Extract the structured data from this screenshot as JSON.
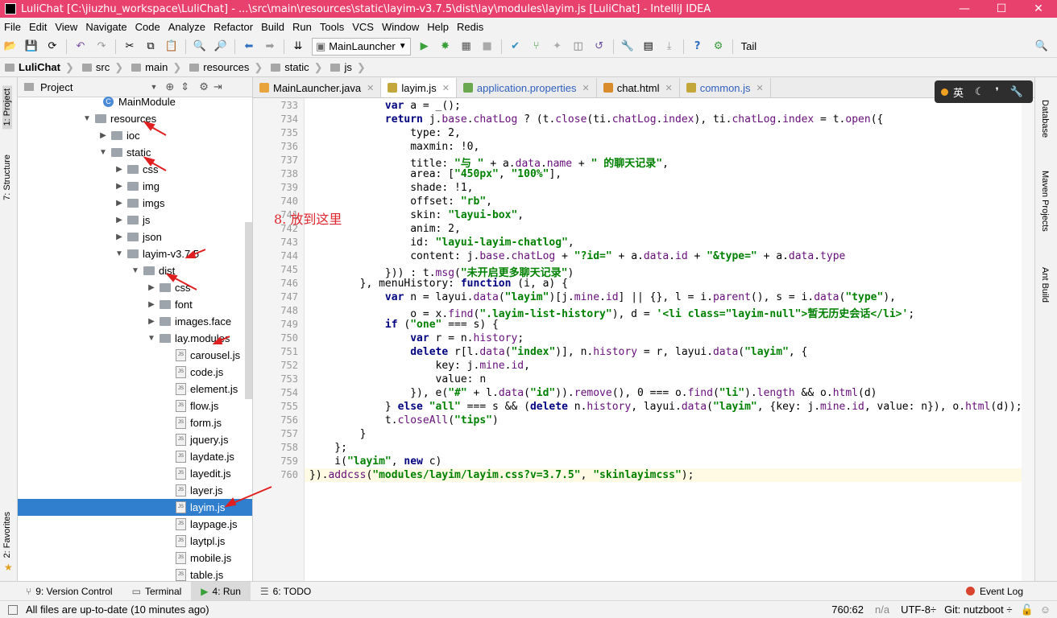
{
  "window": {
    "title": "LuliChat [C:\\jiuzhu_workspace\\LuliChat] - ...\\src\\main\\resources\\static\\layim-v3.7.5\\dist\\lay\\modules\\layim.js [LuliChat] - IntelliJ IDEA",
    "minimize": "—",
    "maximize": "☐",
    "close": "✕"
  },
  "menu": [
    "File",
    "Edit",
    "View",
    "Navigate",
    "Code",
    "Analyze",
    "Refactor",
    "Build",
    "Run",
    "Tools",
    "VCS",
    "Window",
    "Help",
    "Redis"
  ],
  "toolbar": {
    "run_config": "MainLauncher",
    "tail": "Tail"
  },
  "breadcrumb": [
    "LuliChat",
    "src",
    "main",
    "resources",
    "static",
    "js"
  ],
  "project_panel": {
    "title": "Project",
    "tree": [
      {
        "label": "MainModule",
        "kind": "class",
        "indent": 0,
        "caret": ""
      },
      {
        "label": "resources",
        "kind": "folder",
        "indent": 0,
        "caret": "▼"
      },
      {
        "label": "ioc",
        "kind": "folder",
        "indent": 1,
        "caret": "▶"
      },
      {
        "label": "static",
        "kind": "folder",
        "indent": 1,
        "caret": "▼"
      },
      {
        "label": "css",
        "kind": "folder",
        "indent": 2,
        "caret": "▶"
      },
      {
        "label": "img",
        "kind": "folder",
        "indent": 2,
        "caret": "▶"
      },
      {
        "label": "imgs",
        "kind": "folder",
        "indent": 2,
        "caret": "▶"
      },
      {
        "label": "js",
        "kind": "folder",
        "indent": 2,
        "caret": "▶"
      },
      {
        "label": "json",
        "kind": "folder",
        "indent": 2,
        "caret": "▶"
      },
      {
        "label": "layim-v3.7.5",
        "kind": "folder",
        "indent": 2,
        "caret": "▼"
      },
      {
        "label": "dist",
        "kind": "folder",
        "indent": 3,
        "caret": "▼"
      },
      {
        "label": "css",
        "kind": "folder",
        "indent": 4,
        "caret": "▶"
      },
      {
        "label": "font",
        "kind": "folder",
        "indent": 4,
        "caret": "▶"
      },
      {
        "label": "images.face",
        "kind": "folder",
        "indent": 4,
        "caret": "▶"
      },
      {
        "label": "lay.modules",
        "kind": "folder",
        "indent": 4,
        "caret": "▼"
      },
      {
        "label": "carousel.js",
        "kind": "js",
        "indent": 5,
        "caret": ""
      },
      {
        "label": "code.js",
        "kind": "js",
        "indent": 5,
        "caret": ""
      },
      {
        "label": "element.js",
        "kind": "js",
        "indent": 5,
        "caret": ""
      },
      {
        "label": "flow.js",
        "kind": "js",
        "indent": 5,
        "caret": ""
      },
      {
        "label": "form.js",
        "kind": "js",
        "indent": 5,
        "caret": ""
      },
      {
        "label": "jquery.js",
        "kind": "js",
        "indent": 5,
        "caret": ""
      },
      {
        "label": "laydate.js",
        "kind": "js",
        "indent": 5,
        "caret": ""
      },
      {
        "label": "layedit.js",
        "kind": "js",
        "indent": 5,
        "caret": ""
      },
      {
        "label": "layer.js",
        "kind": "js",
        "indent": 5,
        "caret": ""
      },
      {
        "label": "layim.js",
        "kind": "js",
        "indent": 5,
        "caret": "",
        "selected": true
      },
      {
        "label": "laypage.js",
        "kind": "js",
        "indent": 5,
        "caret": ""
      },
      {
        "label": "laytpl.js",
        "kind": "js",
        "indent": 5,
        "caret": ""
      },
      {
        "label": "mobile.js",
        "kind": "js",
        "indent": 5,
        "caret": ""
      },
      {
        "label": "table.js",
        "kind": "js",
        "indent": 5,
        "caret": ""
      }
    ]
  },
  "left_tool_tabs": [
    "1: Project",
    "7: Structure",
    "2: Favorites"
  ],
  "right_tool_tabs": [
    "Database",
    "Maven Projects",
    "Ant Build"
  ],
  "editor_tabs": [
    {
      "label": "MainLauncher.java",
      "active": false
    },
    {
      "label": "layim.js",
      "active": true
    },
    {
      "label": "application.properties",
      "active": false
    },
    {
      "label": "chat.html",
      "active": false
    },
    {
      "label": "common.js",
      "active": false
    }
  ],
  "ime": {
    "label": "英"
  },
  "annotation": "8. 放到这里",
  "editor": {
    "lines": [
      {
        "n": "733",
        "t": "            var a = _();"
      },
      {
        "n": "734",
        "t": "            return j.base.chatLog ? (t.close(ti.chatLog.index), ti.chatLog.index = t.open({"
      },
      {
        "n": "735",
        "t": "                type: 2,"
      },
      {
        "n": "736",
        "t": "                maxmin: !0,"
      },
      {
        "n": "737",
        "t": "                title: \"与 \" + a.data.name + \" 的聊天记录\","
      },
      {
        "n": "738",
        "t": "                area: [\"450px\", \"100%\"],"
      },
      {
        "n": "739",
        "t": "                shade: !1,"
      },
      {
        "n": "740",
        "t": "                offset: \"rb\","
      },
      {
        "n": "741",
        "t": "                skin: \"layui-box\","
      },
      {
        "n": "742",
        "t": "                anim: 2,"
      },
      {
        "n": "743",
        "t": "                id: \"layui-layim-chatlog\","
      },
      {
        "n": "744",
        "t": "                content: j.base.chatLog + \"?id=\" + a.data.id + \"&type=\" + a.data.type"
      },
      {
        "n": "745",
        "t": "            })) : t.msg(\"未开启更多聊天记录\")"
      },
      {
        "n": "746",
        "t": "        }, menuHistory: function (i, a) {"
      },
      {
        "n": "747",
        "t": "            var n = layui.data(\"layim\")[j.mine.id] || {}, l = i.parent(), s = i.data(\"type\"),"
      },
      {
        "n": "748",
        "t": "                o = x.find(\".layim-list-history\"), d = '<li class=\"layim-null\">暂无历史会话</li>';"
      },
      {
        "n": "749",
        "t": "            if (\"one\" === s) {"
      },
      {
        "n": "750",
        "t": "                var r = n.history;"
      },
      {
        "n": "751",
        "t": "                delete r[l.data(\"index\")], n.history = r, layui.data(\"layim\", {"
      },
      {
        "n": "752",
        "t": "                    key: j.mine.id,"
      },
      {
        "n": "753",
        "t": "                    value: n"
      },
      {
        "n": "754",
        "t": "                }), e(\"#\" + l.data(\"id\")).remove(), 0 === o.find(\"li\").length && o.html(d)"
      },
      {
        "n": "755",
        "t": "            } else \"all\" === s && (delete n.history, layui.data(\"layim\", {key: j.mine.id, value: n}), o.html(d));"
      },
      {
        "n": "756",
        "t": "            t.closeAll(\"tips\")"
      },
      {
        "n": "757",
        "t": "        }"
      },
      {
        "n": "758",
        "t": "    };"
      },
      {
        "n": "759",
        "t": "    i(\"layim\", new c)"
      },
      {
        "n": "760",
        "t": "}).addcss(\"modules/layim/layim.css?v=3.7.5\", \"skinlayimcss\");"
      }
    ]
  },
  "bottom_tabs": [
    "9: Version Control",
    "Terminal",
    "4: Run",
    "6: TODO"
  ],
  "event_log": "Event Log",
  "status": {
    "message": "All files are up-to-date (10 minutes ago)",
    "position": "760:62",
    "na": "n/a",
    "encoding": "UTF-8÷",
    "git": "Git: nutzboot ÷"
  },
  "colors": {
    "titlebar": "#e8416e",
    "selection": "#2f7fce",
    "annotation": "#e0262f"
  }
}
